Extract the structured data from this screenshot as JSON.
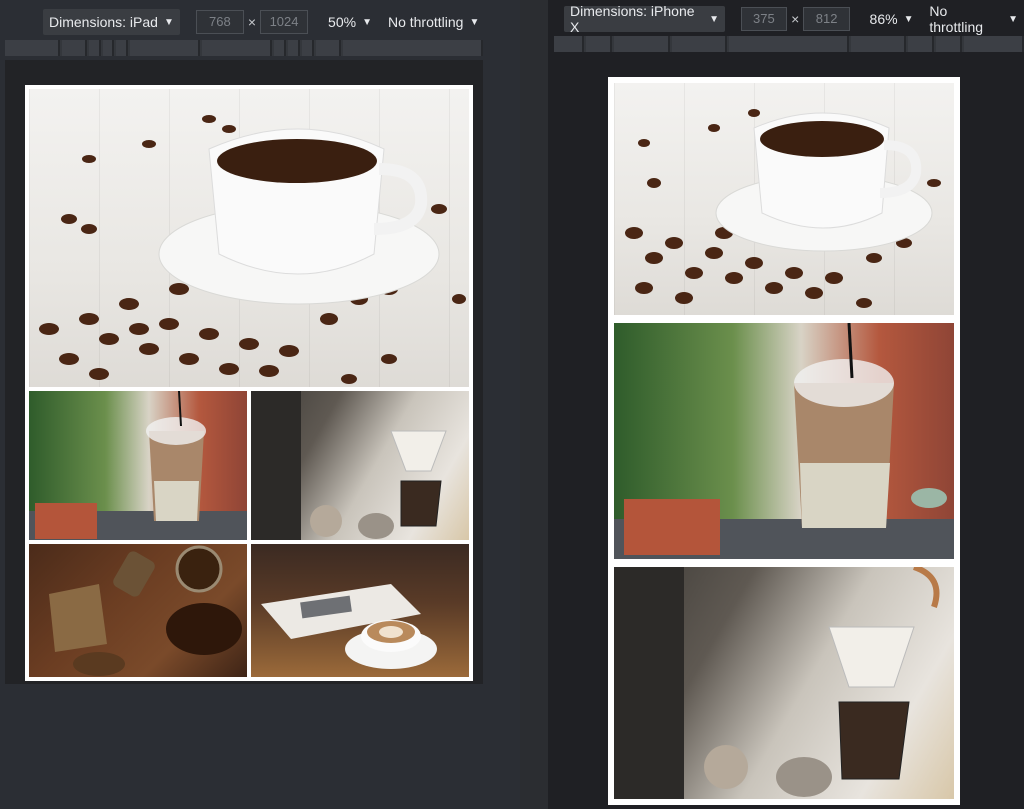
{
  "ipad_toolbar": {
    "device_label": "Dimensions: iPad",
    "width_value": "768",
    "height_value": "1024",
    "times": "×",
    "zoom_label": "50%",
    "throttle_label": "No throttling"
  },
  "iphone_toolbar": {
    "device_label": "Dimensions: iPhone X",
    "width_value": "375",
    "height_value": "812",
    "times": "×",
    "zoom_label": "86%",
    "throttle_label": "No throttling"
  },
  "icons": {
    "caret": "▼"
  },
  "colors": {
    "toolbar_bg": "#2b2e34",
    "frame": "#ffffff",
    "coffee": "#3a1f10"
  }
}
